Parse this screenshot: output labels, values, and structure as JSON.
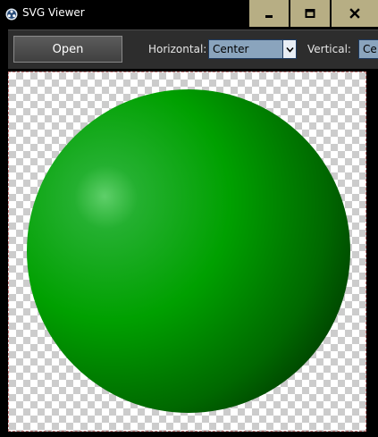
{
  "window": {
    "title": "SVG Viewer",
    "icon": "svg-viewer-app-icon",
    "controls": {
      "minimize_glyph": "▁",
      "maximize_glyph": "▢",
      "close_glyph": "✕"
    }
  },
  "toolbar": {
    "open_label": "Open",
    "horizontal_label": "Horizontal:",
    "horizontal_value": "Center",
    "vertical_label": "Vertical:",
    "vertical_value": "Ce"
  },
  "canvas": {
    "background": "transparency-checkerboard",
    "content": "green-sphere",
    "colors": {
      "highlight": "#5fcf6a",
      "mid": "#00a000",
      "shadow": "#003a00"
    }
  }
}
